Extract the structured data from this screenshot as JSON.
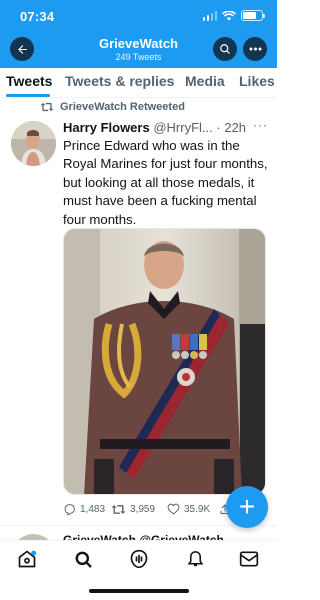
{
  "status_bar": {
    "time": "07:34"
  },
  "header": {
    "title": "GrieveWatch",
    "subtitle": "249 Tweets"
  },
  "tabs": [
    {
      "label": "Tweets",
      "active": true
    },
    {
      "label": "Tweets & replies",
      "active": false
    },
    {
      "label": "Media",
      "active": false
    },
    {
      "label": "Likes",
      "active": false
    }
  ],
  "tweet": {
    "retweet_label": "GrieveWatch Retweeted",
    "author_name": "Harry Flowers",
    "author_handle": "@HrryFl...",
    "separator": "·",
    "time": "22h",
    "text": "Prince Edward who was in the Royal Marines for just four months, but looking at all those medals, it must have been a fucking mental four months.",
    "stats": {
      "replies": "1,483",
      "retweets": "3,959",
      "likes": "35.9K"
    }
  },
  "next_tweet": {
    "partial_text": "GrieveWatch @GrieveWatch"
  },
  "colors": {
    "accent": "#1d9bf0",
    "text": "#0f1419",
    "muted": "#536471"
  },
  "icons": {
    "back": "arrow-left-icon",
    "search": "search-icon",
    "more": "more-icon",
    "retweet": "retweet-icon",
    "reply": "reply-icon",
    "like": "heart-icon",
    "share": "share-icon",
    "compose": "compose-plus-icon",
    "nav_home": "home-icon",
    "nav_search": "search-icon",
    "nav_spaces": "spaces-icon",
    "nav_notifications": "bell-icon",
    "nav_messages": "mail-icon"
  }
}
